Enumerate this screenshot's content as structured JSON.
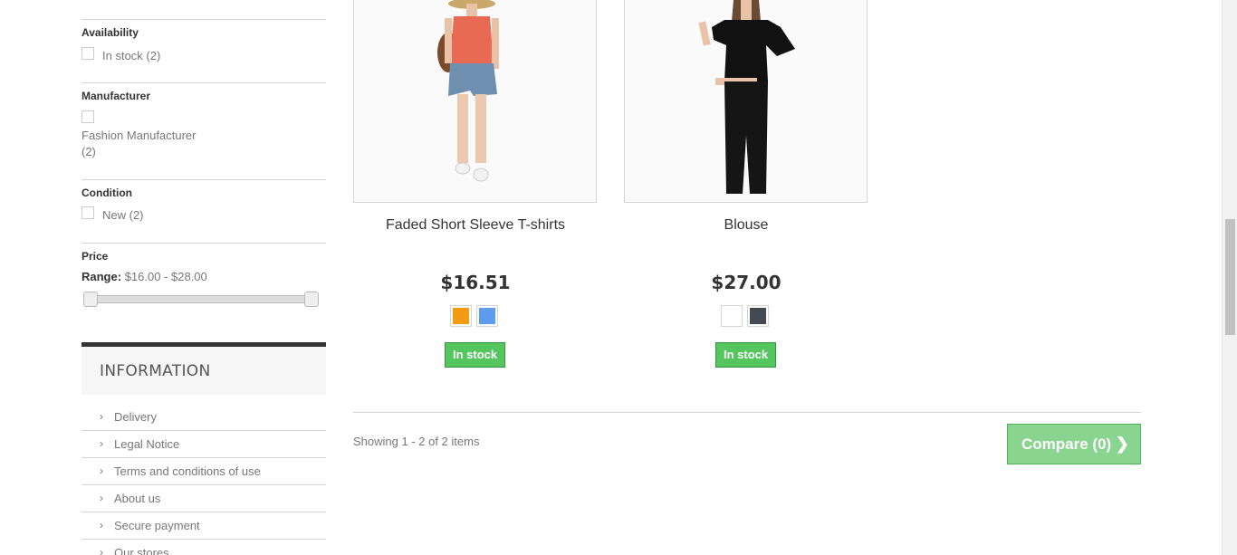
{
  "filters": {
    "availability": {
      "title": "Availability",
      "option": "In stock (2)"
    },
    "manufacturer": {
      "title": "Manufacturer",
      "option_line1": "Fashion Manufacturer",
      "option_line2": "(2)"
    },
    "condition": {
      "title": "Condition",
      "option": "New (2)"
    },
    "price": {
      "title": "Price",
      "range_label": "Range:",
      "range_value": "$16.00 - $28.00",
      "min": 16.0,
      "max": 28.0
    }
  },
  "information": {
    "title": "INFORMATION",
    "items": [
      {
        "label": "Delivery"
      },
      {
        "label": "Legal Notice"
      },
      {
        "label": "Terms and conditions of use"
      },
      {
        "label": "About us"
      },
      {
        "label": "Secure payment"
      },
      {
        "label": "Our stores"
      }
    ]
  },
  "products": [
    {
      "name": "Faded Short Sleeve T-shirts",
      "price": "$16.51",
      "colors": [
        "#f39c11",
        "#5d9cec"
      ],
      "stock": "In stock"
    },
    {
      "name": "Blouse",
      "price": "$27.00",
      "colors": [
        "#ffffff",
        "#434a54"
      ],
      "stock": "In stock"
    }
  ],
  "footer": {
    "showing": "Showing 1 - 2 of 2 items",
    "compare_label": "Compare (0)"
  }
}
